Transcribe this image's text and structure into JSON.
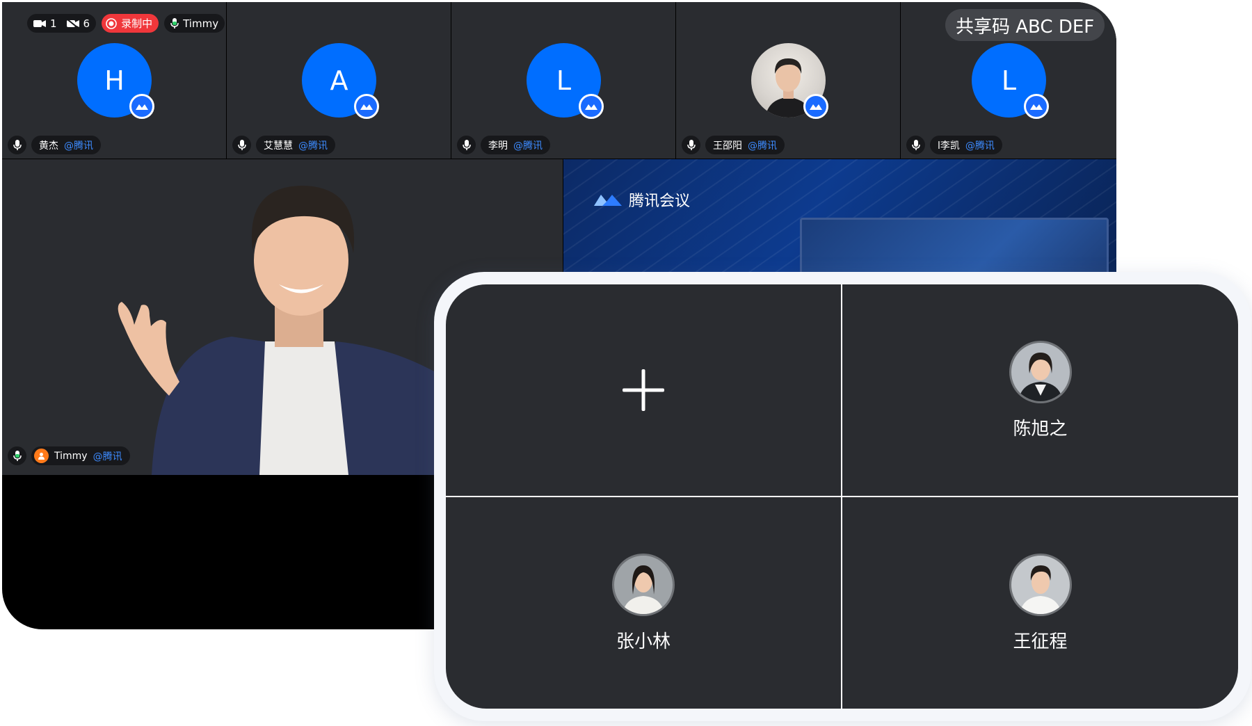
{
  "status_bar": {
    "video_count": "1",
    "video_off_count": "6",
    "recording_label": "录制中",
    "speaking_user": "Timmy"
  },
  "share_code": "共享码 ABC DEF",
  "participants": [
    {
      "initial": "H",
      "name": "黄杰",
      "org": "@腾讯"
    },
    {
      "initial": "A",
      "name": "艾慧慧",
      "org": "@腾讯"
    },
    {
      "initial": "L",
      "name": "李明",
      "org": "@腾讯"
    },
    {
      "initial": "",
      "name": "王邵阳",
      "org": "@腾讯"
    },
    {
      "initial": "L",
      "name": "l李凯",
      "org": "@腾讯"
    }
  ],
  "speaker": {
    "name": "Timmy",
    "org": "@腾讯"
  },
  "share": {
    "app_title": "腾讯会议"
  },
  "panel": {
    "add_icon": "plus-icon",
    "members": [
      {
        "name": "陈旭之"
      },
      {
        "name": "张小林"
      },
      {
        "name": "王征程"
      }
    ]
  },
  "colors": {
    "brand_blue": "#006eff",
    "tile_bg": "#2a2c30",
    "recording_red": "#f0373b",
    "org_link_blue": "#3d8bff"
  }
}
